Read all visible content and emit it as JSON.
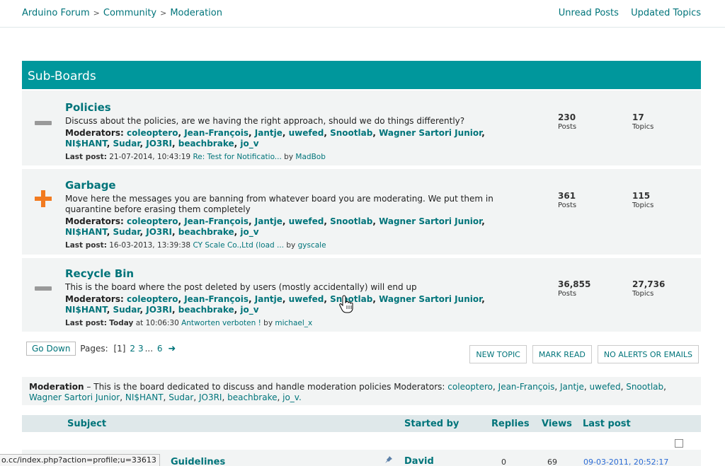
{
  "breadcrumb": {
    "items": [
      "Arduino Forum",
      "Community",
      "Moderation"
    ],
    "separator": ">"
  },
  "toplinks": {
    "unread": "Unread Posts",
    "updated": "Updated Topics"
  },
  "subboards_title": "Sub-Boards",
  "boards": [
    {
      "icon": "minus-icon",
      "title": "Policies",
      "description": "Discuss about the policies, are we having the right approach, should we do things differently?",
      "mods_label": "Moderators:",
      "moderators": [
        "coleoptero",
        "Jean-François",
        "Jantje",
        "uwefed",
        "Snootlab",
        "Wagner Sartori Junior",
        "NI$HANT",
        "Sudar",
        "JO3RI",
        "beachbrake",
        "jo_v"
      ],
      "lastpost_label": "Last post:",
      "lastpost_date": "21-07-2014, 10:43:19",
      "lastpost_link": "Re: Test for Notificatio...",
      "lastpost_by": "by",
      "lastpost_user": "MadBob",
      "posts": "230",
      "posts_label": "Posts",
      "topics": "17",
      "topics_label": "Topics"
    },
    {
      "icon": "plus-icon",
      "title": "Garbage",
      "description": "Move here the messages you are banning from whatever board you are moderating. We put them in quarantine before erasing them completely",
      "mods_label": "Moderators:",
      "moderators": [
        "coleoptero",
        "Jean-François",
        "Jantje",
        "uwefed",
        "Snootlab",
        "Wagner Sartori Junior",
        "NI$HANT",
        "Sudar",
        "JO3RI",
        "beachbrake",
        "jo_v"
      ],
      "lastpost_label": "Last post:",
      "lastpost_date": "16-03-2013, 13:39:38",
      "lastpost_link": "CY Scale Co.,Ltd (load ...",
      "lastpost_by": "by",
      "lastpost_user": "gyscale",
      "posts": "361",
      "posts_label": "Posts",
      "topics": "115",
      "topics_label": "Topics"
    },
    {
      "icon": "minus-icon",
      "title": "Recycle Bin",
      "description": "This is the board where the post deleted by users (mostly accidentally) will end up",
      "mods_label": "Moderators:",
      "moderators": [
        "coleoptero",
        "Jean-François",
        "Jantje",
        "uwefed",
        "Snootlab",
        "Wagner Sartori Junior",
        "NI$HANT",
        "Sudar",
        "JO3RI",
        "beachbrake",
        "jo_v"
      ],
      "lastpost_label": "Last post:",
      "lastpost_today": "Today",
      "lastpost_date": "at 10:06:30",
      "lastpost_link": "Antworten verboten !",
      "lastpost_by": "by",
      "lastpost_user": "michael_x",
      "posts": "36,855",
      "posts_label": "Posts",
      "topics": "27,736",
      "topics_label": "Topics"
    }
  ],
  "pager": {
    "godown": "Go Down",
    "pages_label": "Pages:",
    "current": "[1]",
    "p2": "2",
    "p3": "3",
    "ellipsis": "...",
    "p6": "6"
  },
  "actions": {
    "new_topic": "NEW TOPIC",
    "mark_read": "MARK READ",
    "no_alerts": "NO ALERTS OR EMAILS"
  },
  "modinfo": {
    "board": "Moderation",
    "dash": "–",
    "description": "This is the board dedicated to discuss and handle moderation policies",
    "mods_label": "Moderators:",
    "moderators": [
      "coleoptero",
      "Jean-François",
      "Jantje",
      "uwefed",
      "Snootlab",
      "Wagner Sartori Junior",
      "NI$HANT",
      "Sudar",
      "JO3RI",
      "beachbrake",
      "jo_v."
    ]
  },
  "table": {
    "subject": "Subject",
    "started_by": "Started by",
    "replies": "Replies",
    "views": "Views",
    "last_post": "Last post"
  },
  "topic": {
    "title": "Guidelines",
    "starter": "David",
    "replies": "0",
    "views": "69",
    "last": "09-03-2011, 20:52:17"
  },
  "statusbar": "o.cc/index.php?action=profile;u=33613",
  "colors": {
    "accent": "#00979c",
    "link": "#00747a",
    "plus": "#f27b21"
  }
}
